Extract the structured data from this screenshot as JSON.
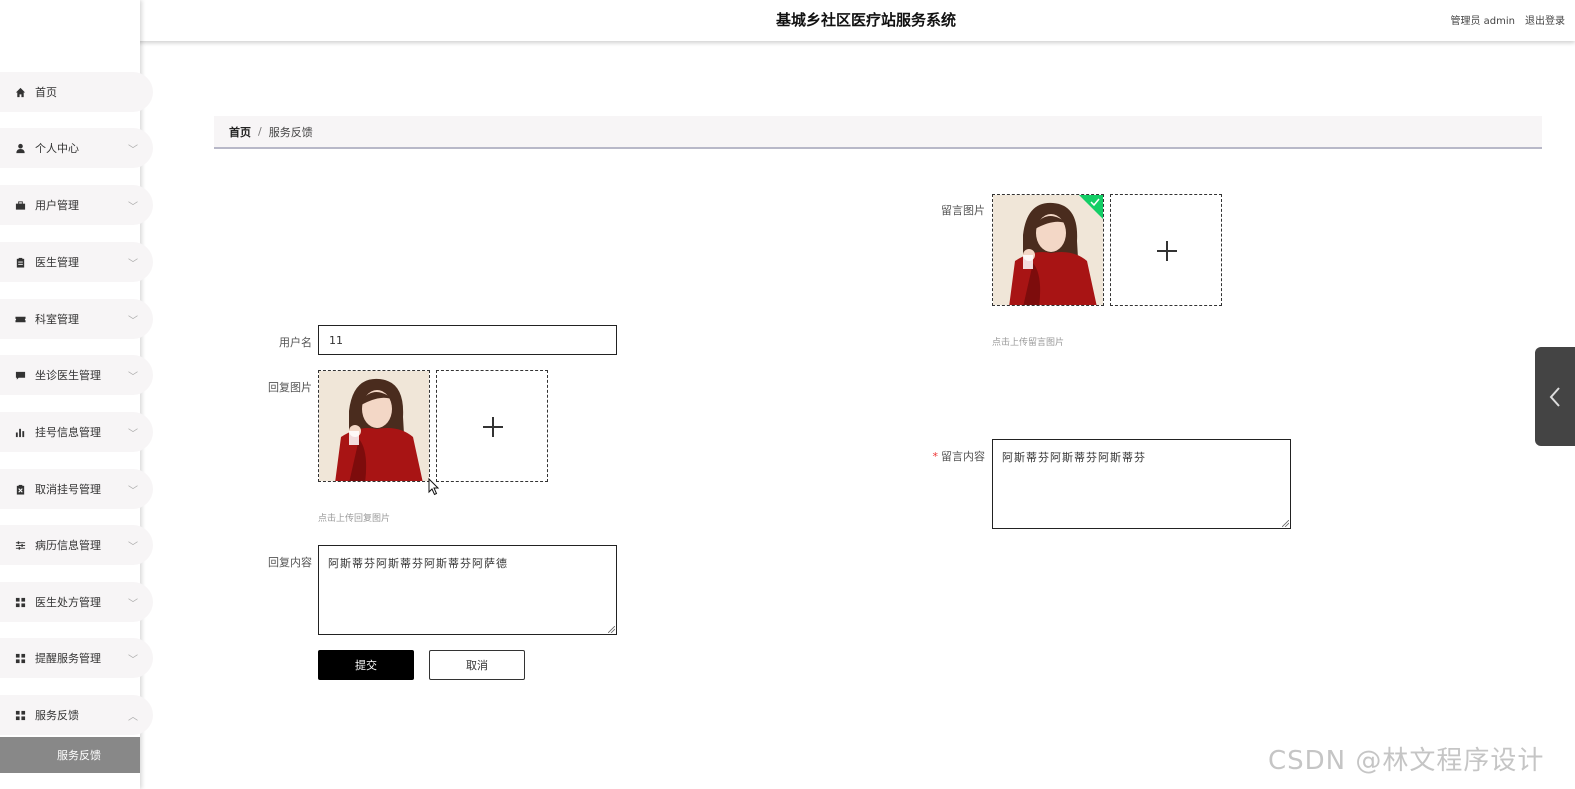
{
  "header": {
    "title": "基城乡社区医疗站服务系统",
    "role_user": "管理员 admin",
    "logout": "退出登录"
  },
  "sidebar": {
    "items": [
      {
        "label": "首页",
        "icon": "home-icon",
        "chevron": false
      },
      {
        "label": "个人中心",
        "icon": "user-icon",
        "chevron": true
      },
      {
        "label": "用户管理",
        "icon": "briefcase-icon",
        "chevron": true
      },
      {
        "label": "医生管理",
        "icon": "clipboard-icon",
        "chevron": true
      },
      {
        "label": "科室管理",
        "icon": "ticket-icon",
        "chevron": true
      },
      {
        "label": "坐诊医生管理",
        "icon": "chat-icon",
        "chevron": true
      },
      {
        "label": "挂号信息管理",
        "icon": "bar-chart-icon",
        "chevron": true
      },
      {
        "label": "取消挂号管理",
        "icon": "clipboard-x-icon",
        "chevron": true
      },
      {
        "label": "病历信息管理",
        "icon": "sliders-icon",
        "chevron": true
      },
      {
        "label": "医生处方管理",
        "icon": "grid-icon",
        "chevron": true
      },
      {
        "label": "提醒服务管理",
        "icon": "grid-icon",
        "chevron": true
      },
      {
        "label": "服务反馈",
        "icon": "grid-icon",
        "chevron": true,
        "expanded": true
      }
    ],
    "submenu_active": "服务反馈"
  },
  "breadcrumb": {
    "home": "首页",
    "separator": "/",
    "current": "服务反馈"
  },
  "form": {
    "message_image_label": "留言图片",
    "message_image_hint": "点击上传留言图片",
    "username_label": "用户名",
    "username_value": "11",
    "reply_image_label": "回复图片",
    "reply_image_hint": "点击上传回复图片",
    "message_content_required": "*",
    "message_content_label": "留言内容",
    "message_content_value": "阿斯蒂芬阿斯蒂芬阿斯蒂芬",
    "reply_content_label": "回复内容",
    "reply_content_value": "阿斯蒂芬阿斯蒂芬阿斯蒂芬阿萨德",
    "submit_label": "提交",
    "cancel_label": "取消"
  },
  "watermark": "CSDN @林文程序设计",
  "colors": {
    "accent": "#000000",
    "menu_bg": "#f7f5f6",
    "submenu_active_bg": "#888888",
    "success_badge": "#13ce66"
  }
}
